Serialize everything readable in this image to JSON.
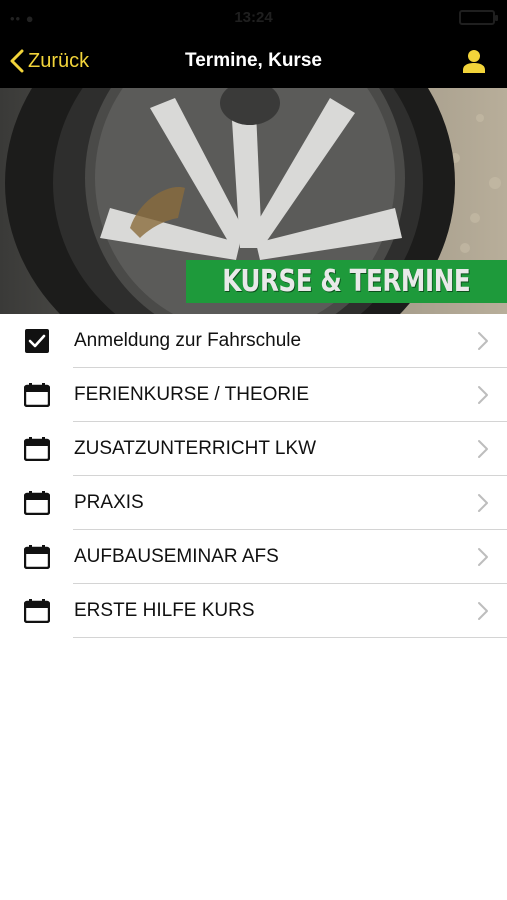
{
  "status_bar": {
    "signal": "•• ●",
    "time": "13:24"
  },
  "nav": {
    "back_label": "Zurück",
    "title": "Termine, Kurse",
    "accent_color": "#f2d43a"
  },
  "hero": {
    "banner_text": "KURSE & TERMINE",
    "banner_color": "#1e9a3b"
  },
  "menu": {
    "items": [
      {
        "label": "Anmeldung zur Fahrschule",
        "icon": "checkbox-icon"
      },
      {
        "label": "FERIENKURSE / THEORIE",
        "icon": "calendar-icon"
      },
      {
        "label": "ZUSATZUNTERRICHT LKW",
        "icon": "calendar-icon"
      },
      {
        "label": "PRAXIS",
        "icon": "calendar-icon"
      },
      {
        "label": "AUFBAUSEMINAR AFS",
        "icon": "calendar-icon"
      },
      {
        "label": "ERSTE HILFE KURS",
        "icon": "calendar-icon"
      }
    ]
  }
}
